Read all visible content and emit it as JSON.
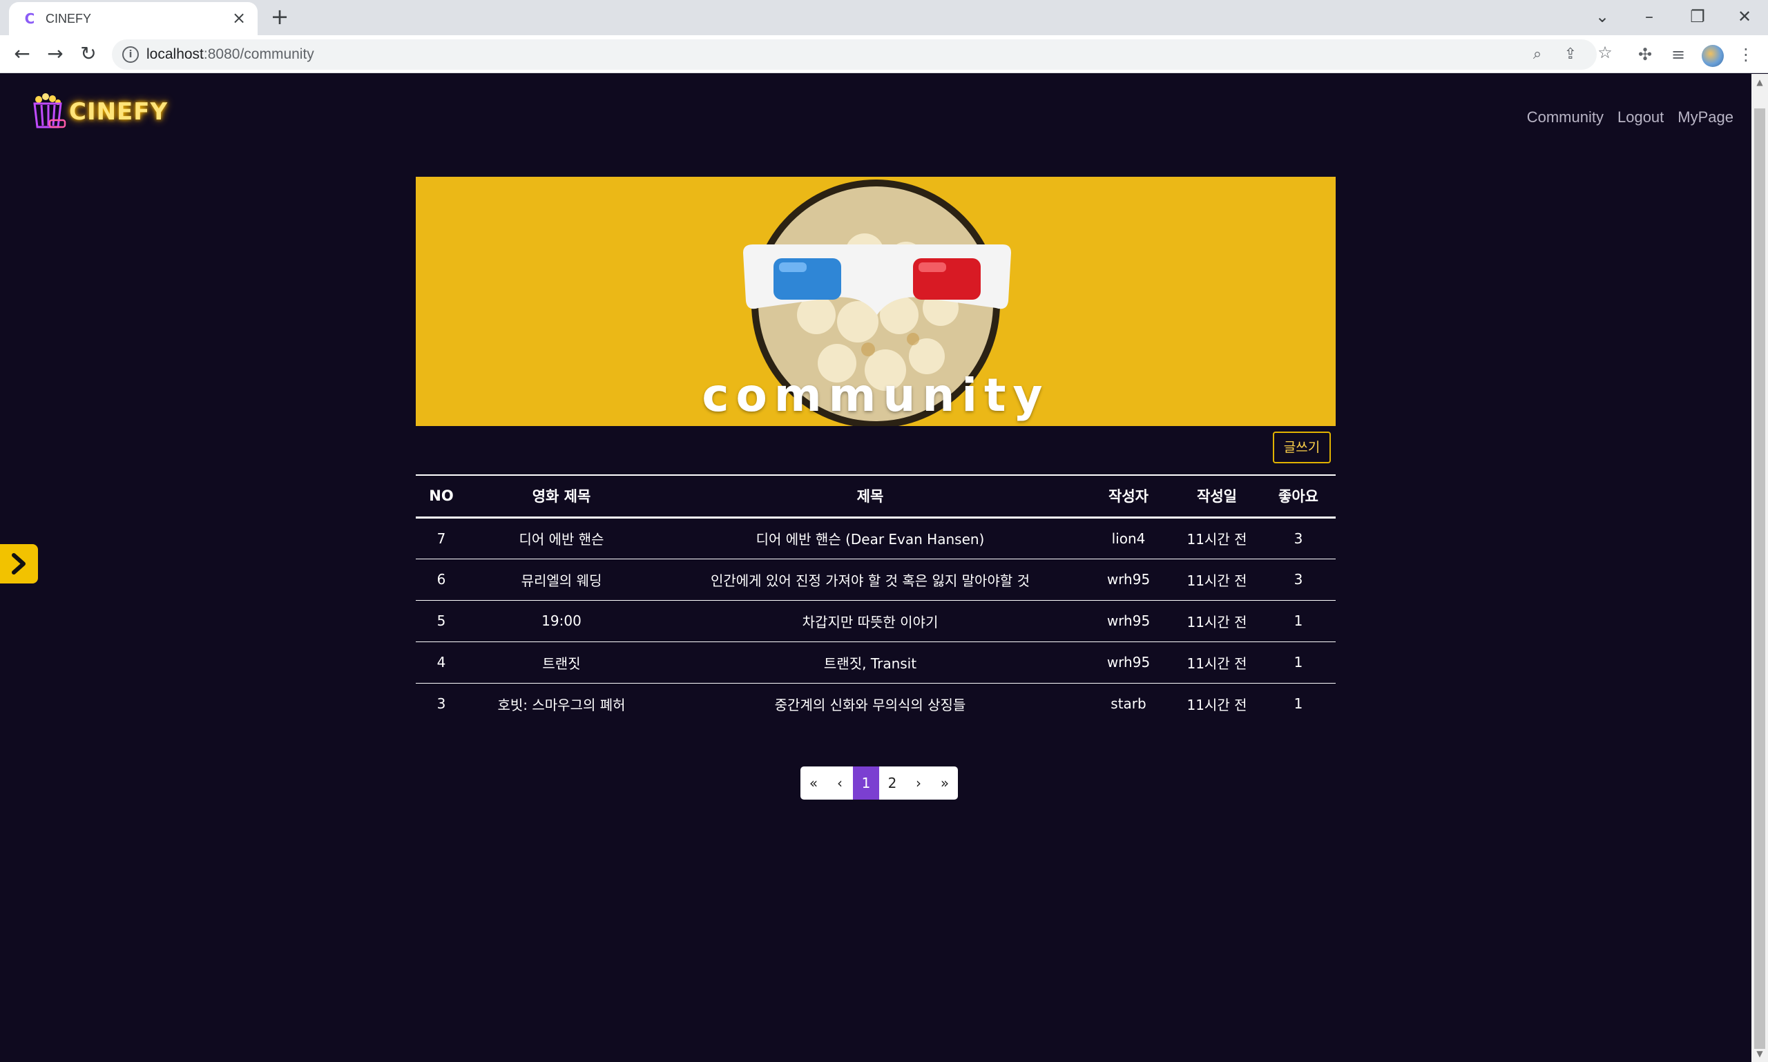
{
  "browser": {
    "tab_title": "CINEFY",
    "url_host": "localhost",
    "url_path": ":8080/community"
  },
  "site": {
    "logo_text": "CINEFY",
    "nav": [
      "Community",
      "Logout",
      "MyPage"
    ]
  },
  "banner": {
    "title": "community"
  },
  "write_button": "글쓰기",
  "table": {
    "headers": [
      "NO",
      "영화 제목",
      "제목",
      "작성자",
      "작성일",
      "좋아요"
    ],
    "rows": [
      [
        "7",
        "디어 에반 핸슨",
        "디어 에반 핸슨 (Dear Evan Hansen)",
        "lion4",
        "11시간 전",
        "3"
      ],
      [
        "6",
        "뮤리엘의 웨딩",
        "인간에게 있어 진정 가져야 할 것 혹은 잃지 말아야할 것",
        "wrh95",
        "11시간 전",
        "3"
      ],
      [
        "5",
        "19:00",
        "차갑지만 따뜻한 이야기",
        "wrh95",
        "11시간 전",
        "1"
      ],
      [
        "4",
        "트랜짓",
        "트랜짓, Transit",
        "wrh95",
        "11시간 전",
        "1"
      ],
      [
        "3",
        "호빗: 스마우그의 폐허",
        "중간계의 신화와 무의식의 상징들",
        "starb",
        "11시간 전",
        "1"
      ]
    ]
  },
  "pagination": [
    "«",
    "‹",
    "1",
    "2",
    "›",
    "»"
  ],
  "pagination_active": "1",
  "colors": {
    "page_bg": "#0f0a1f",
    "banner_bg": "#ebb817",
    "accent": "#f2c200",
    "page_active": "#7b3fd1"
  }
}
